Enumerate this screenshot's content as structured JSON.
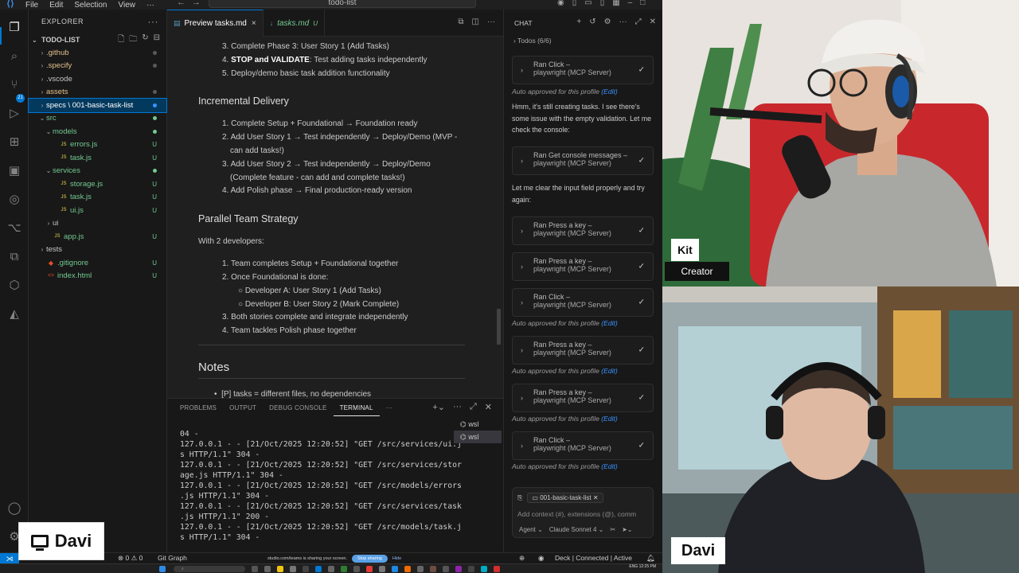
{
  "titlebar": {
    "menu": [
      "File",
      "Edit",
      "Selection",
      "View",
      "···"
    ],
    "command_center": "todo-list"
  },
  "activity_badge": "21",
  "explorer": {
    "header": "EXPLORER",
    "project": "TODO-LIST",
    "items": [
      {
        "label": ".github",
        "kind": "folder",
        "depth": 1,
        "open": false,
        "status": "dot"
      },
      {
        "label": ".specify",
        "kind": "folder",
        "depth": 1,
        "open": false,
        "status": "dot"
      },
      {
        "label": ".vscode",
        "kind": "folder",
        "depth": 1,
        "open": false,
        "status": ""
      },
      {
        "label": "assets",
        "kind": "folder",
        "depth": 1,
        "open": false,
        "status": "dot"
      },
      {
        "label": "specs \\ 001-basic-task-list",
        "kind": "folder",
        "depth": 1,
        "open": false,
        "status": "dot",
        "selected": true
      },
      {
        "label": "src",
        "kind": "folder",
        "depth": 1,
        "open": true,
        "status": "dot-green"
      },
      {
        "label": "models",
        "kind": "folder",
        "depth": 2,
        "open": true,
        "status": "dot-green"
      },
      {
        "label": "errors.js",
        "kind": "js",
        "depth": 3,
        "status": "U"
      },
      {
        "label": "task.js",
        "kind": "js",
        "depth": 3,
        "status": "U"
      },
      {
        "label": "services",
        "kind": "folder",
        "depth": 2,
        "open": true,
        "status": "dot-green"
      },
      {
        "label": "storage.js",
        "kind": "js",
        "depth": 3,
        "status": "U"
      },
      {
        "label": "task.js",
        "kind": "js",
        "depth": 3,
        "status": "U"
      },
      {
        "label": "ui.js",
        "kind": "js",
        "depth": 3,
        "status": "U"
      },
      {
        "label": "ui",
        "kind": "folder",
        "depth": 2,
        "open": false,
        "status": ""
      },
      {
        "label": "app.js",
        "kind": "js",
        "depth": 2,
        "status": "U"
      },
      {
        "label": "tests",
        "kind": "folder",
        "depth": 1,
        "open": false,
        "status": ""
      },
      {
        "label": ".gitignore",
        "kind": "git",
        "depth": 1,
        "status": "U"
      },
      {
        "label": "index.html",
        "kind": "html",
        "depth": 1,
        "status": "U"
      }
    ]
  },
  "tabs": [
    {
      "label": "Preview tasks.md",
      "close": "×",
      "active": true
    },
    {
      "label": "tasks.md",
      "modified": "U",
      "active": false
    }
  ],
  "preview": {
    "top_items": [
      {
        "num": "3.",
        "text": "Complete Phase 3: User Story 1 (Add Tasks)"
      },
      {
        "num": "4.",
        "bold": "STOP and VALIDATE",
        "text": ": Test adding tasks independently"
      },
      {
        "num": "5.",
        "text": "Deploy/demo basic task addition functionality"
      }
    ],
    "h_incremental": "Incremental Delivery",
    "incremental": [
      {
        "num": "1.",
        "text": "Complete Setup + Foundational → Foundation ready"
      },
      {
        "num": "2.",
        "text": "Add User Story 1 → Test independently → Deploy/Demo (MVP -",
        "cont": "can add tasks!)"
      },
      {
        "num": "3.",
        "text": "Add User Story 2 → Test independently → Deploy/Demo",
        "cont": "(Complete feature - can add and complete tasks!)"
      },
      {
        "num": "4.",
        "text": "Add Polish phase → Final production-ready version"
      }
    ],
    "h_parallel": "Parallel Team Strategy",
    "with_devs": "With 2 developers:",
    "parallel": [
      {
        "num": "1.",
        "text": "Team completes Setup + Foundational together"
      },
      {
        "num": "2.",
        "text": "Once Foundational is done:"
      }
    ],
    "sub": [
      "Developer A: User Story 1 (Add Tasks)",
      "Developer B: User Story 2 (Mark Complete)"
    ],
    "parallel_after": [
      {
        "num": "3.",
        "text": "Both stories complete and integrate independently"
      },
      {
        "num": "4.",
        "text": "Team tackles Polish phase together"
      }
    ],
    "h_notes": "Notes",
    "notes": [
      "[P] tasks = different files, no dependencies"
    ]
  },
  "panel": {
    "tabs": [
      "PROBLEMS",
      "OUTPUT",
      "DEBUG CONSOLE",
      "TERMINAL",
      "···"
    ],
    "active_tab": "TERMINAL",
    "terminals": [
      "wsl",
      "wsl"
    ],
    "lines": [
      "04 -",
      "127.0.0.1 - - [21/Oct/2025 12:20:52] \"GET /src/services/ui.j",
      "s HTTP/1.1\" 304 -",
      "127.0.0.1 - - [21/Oct/2025 12:20:52] \"GET /src/services/stor",
      "age.js HTTP/1.1\" 304 -",
      "127.0.0.1 - - [21/Oct/2025 12:20:52] \"GET /src/models/errors",
      ".js HTTP/1.1\" 304 -",
      "127.0.0.1 - - [21/Oct/2025 12:20:52] \"GET /src/services/task",
      ".js HTTP/1.1\" 200 -",
      "127.0.0.1 - - [21/Oct/2025 12:20:52] \"GET /src/models/task.j",
      "s HTTP/1.1\" 304 -"
    ]
  },
  "chat": {
    "header": "CHAT",
    "todos": "Todos (6/6)",
    "auto_text": "Auto approved for this profile",
    "edit_link": "(Edit)",
    "mcp": "playwright (MCP Server)",
    "cards": [
      {
        "title": "Ran Click –"
      },
      {
        "title": "Ran Get console messages –"
      },
      {
        "title": "Ran Press a key –"
      },
      {
        "title": "Ran Press a key –"
      },
      {
        "title": "Ran Click –"
      },
      {
        "title": "Ran Press a key –"
      },
      {
        "title": "Ran Press a key –"
      },
      {
        "title": "Ran Click –"
      }
    ],
    "msg1": "Hmm, it's still creating tasks. I see there's some issue with the empty validation. Let me check the console:",
    "msg2": "Let me clear the input field properly and try again:",
    "context_file": "001-basic-task-list",
    "input_placeholder": "Add context (#), extensions (@), comm",
    "mode": "Agent",
    "model": "Claude Sonnet 4"
  },
  "statusbar": {
    "errors": "0",
    "warnings": "0",
    "git": "Git Graph",
    "share_text": "studio.com/teams is sharing your screen.",
    "stop_sharing": "Stop sharing",
    "hide": "Hide",
    "deck": "Deck | Connected | Active"
  },
  "taskbar": {
    "time": "12:25 PM",
    "lang": "ENG"
  },
  "cameras": {
    "kit_name": "Kit",
    "kit_role": "Creator",
    "davi_name": "Davi",
    "share_name": "Davi"
  }
}
